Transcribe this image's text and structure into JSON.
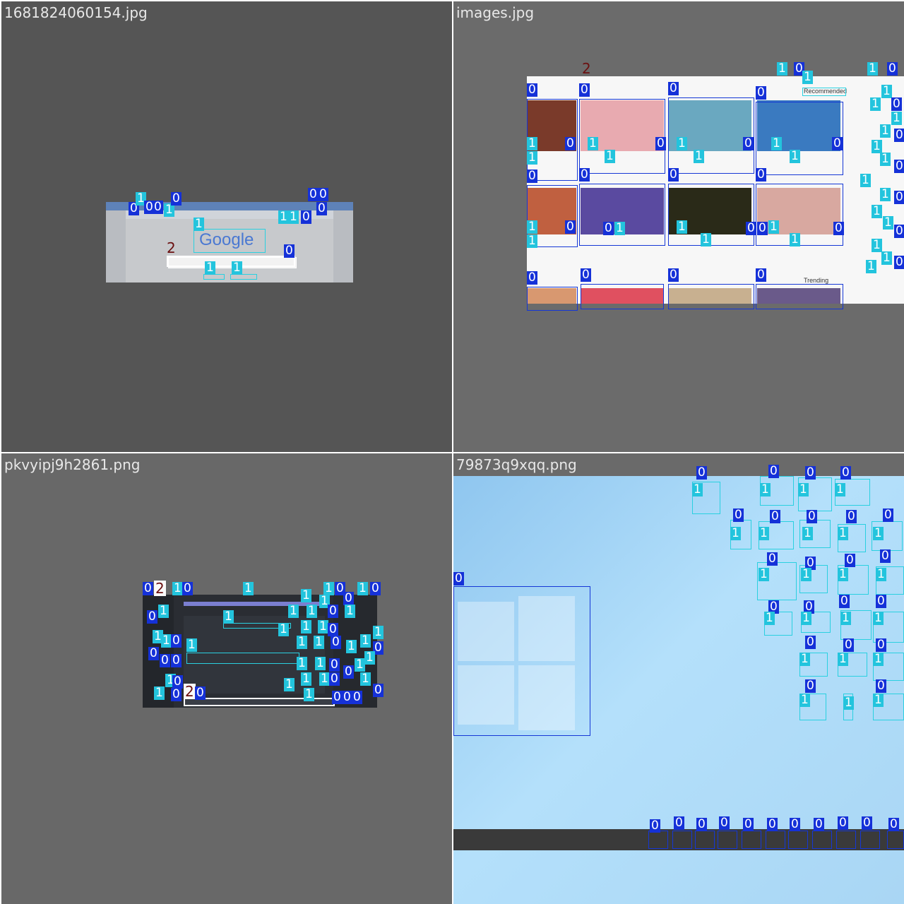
{
  "tiles": [
    {
      "filename": "1681824060154.jpg"
    },
    {
      "filename": "images.jpg"
    },
    {
      "filename": "pkvyipj9h2861.png"
    },
    {
      "filename": "79873q9xqq.png"
    }
  ],
  "class_labels": {
    "zero": "0",
    "one": "1",
    "two": "2"
  },
  "google_page": {
    "logo": "Google"
  },
  "youtube_page": {
    "section_recommended": "Recommended",
    "section_trending": "Trending"
  },
  "colors": {
    "class0_box": "#1531d8",
    "class1_box": "#23c4dd",
    "class2_box": "#ffffff",
    "windows_desktop": "#a9d8f5",
    "taskbar": "#3a3a3a"
  }
}
